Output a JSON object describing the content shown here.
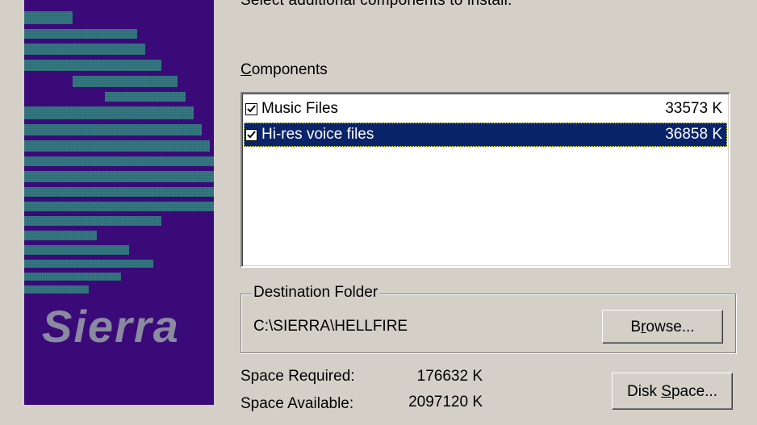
{
  "banner": {
    "brand": "Sierra",
    "bg_color": "#3a0a78",
    "stripe_color": "#2e6e78"
  },
  "instruction": "Select additional components to install.",
  "components": {
    "label_prefix": "",
    "label_accel": "C",
    "label_rest": "omponents",
    "items": [
      {
        "name": "Music Files",
        "size": "33573 K",
        "checked": true,
        "selected": false
      },
      {
        "name": "Hi-res voice files",
        "size": "36858 K",
        "checked": true,
        "selected": true
      }
    ]
  },
  "destination": {
    "title": "Destination Folder",
    "path": "C:\\SIERRA\\HELLFIRE",
    "browse_prefix": "B",
    "browse_accel": "r",
    "browse_rest": "owse..."
  },
  "space": {
    "required_label": "Space Required:",
    "required_value": "176632 K",
    "available_label": "Space Available:",
    "available_value": "2097120 K"
  },
  "disk_button": {
    "prefix": "Disk ",
    "accel": "S",
    "rest": "pace..."
  }
}
